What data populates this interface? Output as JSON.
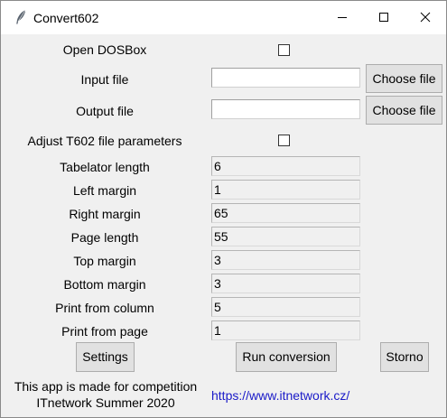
{
  "window": {
    "title": "Convert602"
  },
  "rows": {
    "open_dosbox": {
      "label": "Open DOSBox",
      "checked": false
    },
    "input_file": {
      "label": "Input file",
      "value": "",
      "button": "Choose file"
    },
    "output_file": {
      "label": "Output file",
      "value": "",
      "button": "Choose file"
    },
    "adjust_params": {
      "label": "Adjust T602 file parameters",
      "checked": false
    }
  },
  "params": [
    {
      "label": "Tabelator length",
      "value": "6"
    },
    {
      "label": "Left margin",
      "value": "1"
    },
    {
      "label": "Right margin",
      "value": "65"
    },
    {
      "label": "Page length",
      "value": "55"
    },
    {
      "label": "Top margin",
      "value": "3"
    },
    {
      "label": "Bottom margin",
      "value": "3"
    },
    {
      "label": "Print from column",
      "value": "5"
    },
    {
      "label": "Print from page",
      "value": "1"
    }
  ],
  "buttons": {
    "settings": "Settings",
    "run": "Run conversion",
    "storno": "Storno"
  },
  "footer": {
    "line1": "This app is made for competition",
    "line2": "ITnetwork Summer 2020",
    "link": "https://www.itnetwork.cz/"
  }
}
